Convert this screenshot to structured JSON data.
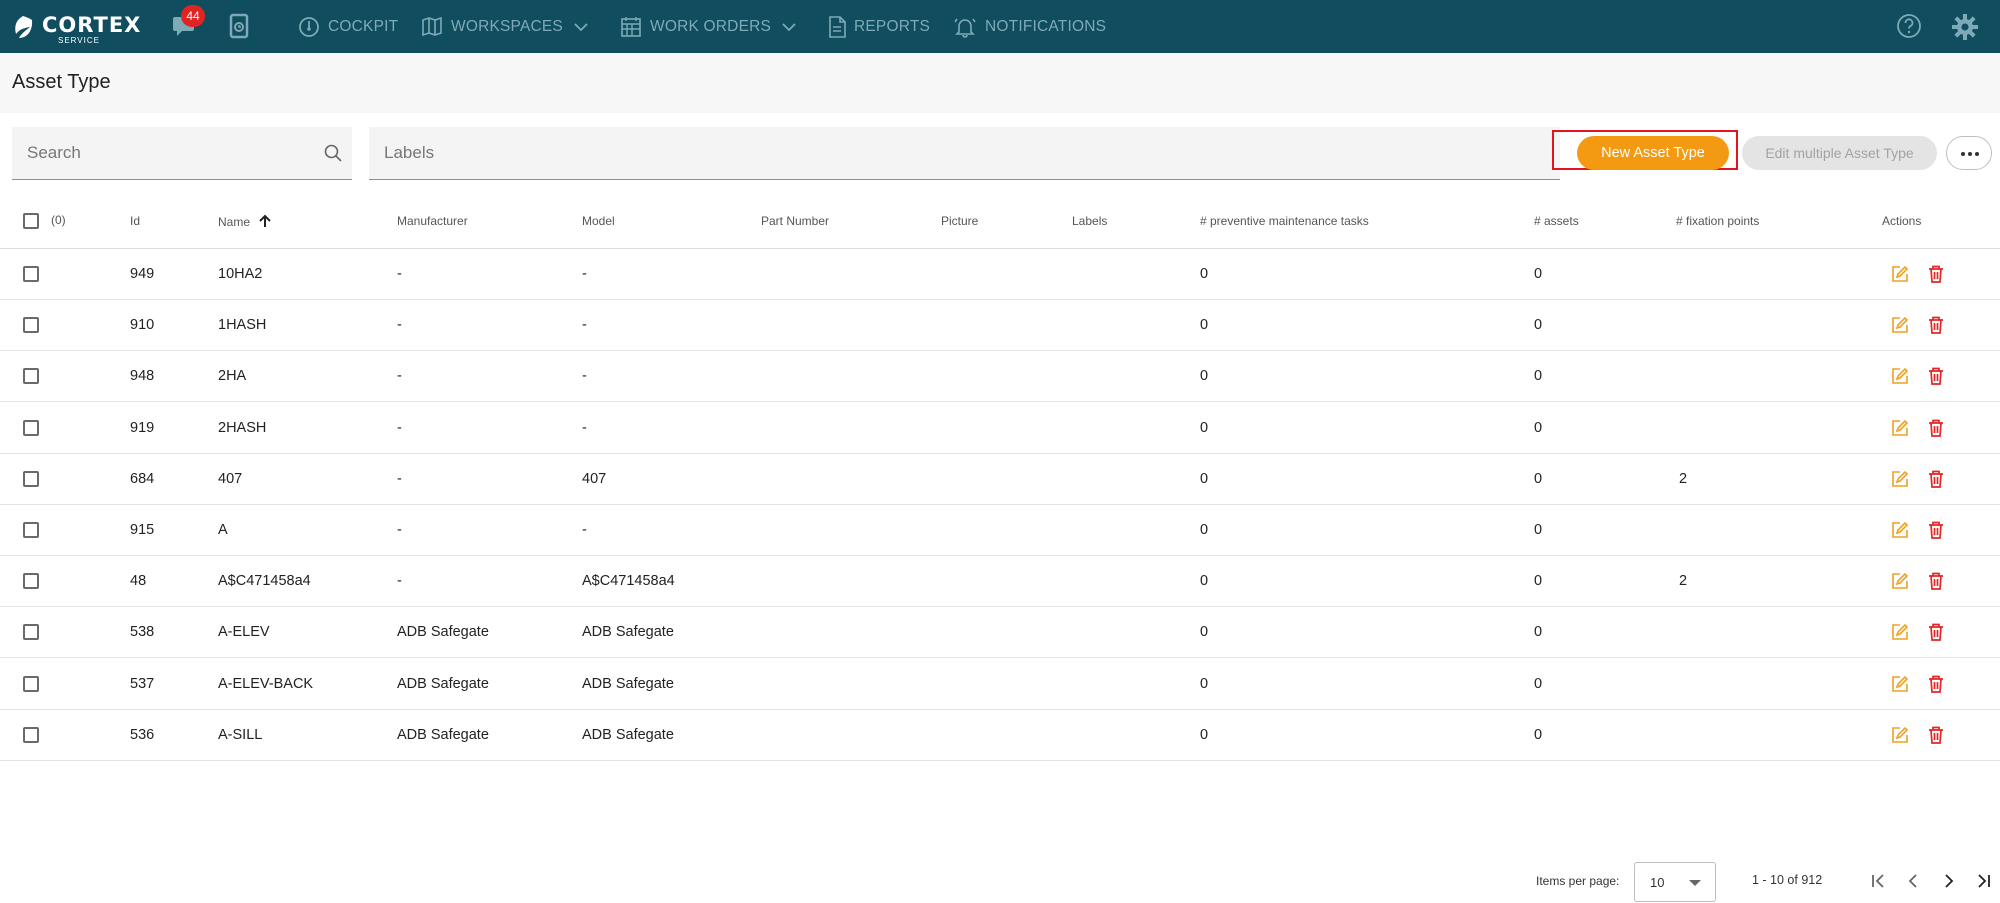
{
  "nav": {
    "brand": "CORTEX",
    "brand_sub": "SERVICE",
    "messages_badge": "44",
    "items": [
      {
        "label": "COCKPIT",
        "icon": "gauge-icon"
      },
      {
        "label": "WORKSPACES",
        "icon": "map-icon"
      },
      {
        "label": "WORK ORDERS",
        "icon": "calendar-icon"
      },
      {
        "label": "REPORTS",
        "icon": "document-icon"
      },
      {
        "label": "NOTIFICATIONS",
        "icon": "bell-icon"
      }
    ],
    "colors": {
      "bar": "#0f4d5f",
      "item": "#7eaab7",
      "badge": "#e02424"
    }
  },
  "page": {
    "title": "Asset Type"
  },
  "filters": {
    "search_placeholder": "Search",
    "labels_placeholder": "Labels"
  },
  "toolbar": {
    "new_label": "New Asset Type",
    "edit_multiple_label": "Edit multiple Asset Type",
    "accent": "#f39a12"
  },
  "table": {
    "selected_count": "(0)",
    "headers": {
      "id": "Id",
      "name": "Name",
      "manufacturer": "Manufacturer",
      "model": "Model",
      "part_number": "Part Number",
      "picture": "Picture",
      "labels": "Labels",
      "pm_tasks": "# preventive maintenance tasks",
      "assets": "# assets",
      "fixation": "# fixation points",
      "actions": "Actions"
    },
    "rows": [
      {
        "id": "949",
        "name": "10HA2",
        "manufacturer": "-",
        "model": "-",
        "pm": "0",
        "assets": "0",
        "fix": ""
      },
      {
        "id": "910",
        "name": "1HASH",
        "manufacturer": "-",
        "model": "-",
        "pm": "0",
        "assets": "0",
        "fix": ""
      },
      {
        "id": "948",
        "name": "2HA",
        "manufacturer": "-",
        "model": "-",
        "pm": "0",
        "assets": "0",
        "fix": ""
      },
      {
        "id": "919",
        "name": "2HASH",
        "manufacturer": "-",
        "model": "-",
        "pm": "0",
        "assets": "0",
        "fix": ""
      },
      {
        "id": "684",
        "name": "407",
        "manufacturer": "-",
        "model": "407",
        "pm": "0",
        "assets": "0",
        "fix": "2"
      },
      {
        "id": "915",
        "name": "A",
        "manufacturer": "-",
        "model": "-",
        "pm": "0",
        "assets": "0",
        "fix": ""
      },
      {
        "id": "48",
        "name": "A$C471458a4",
        "manufacturer": "-",
        "model": "A$C471458a4",
        "pm": "0",
        "assets": "0",
        "fix": "2"
      },
      {
        "id": "538",
        "name": "A-ELEV",
        "manufacturer": "ADB Safegate",
        "model": "ADB Safegate",
        "pm": "0",
        "assets": "0",
        "fix": ""
      },
      {
        "id": "537",
        "name": "A-ELEV-BACK",
        "manufacturer": "ADB Safegate",
        "model": "ADB Safegate",
        "pm": "0",
        "assets": "0",
        "fix": ""
      },
      {
        "id": "536",
        "name": "A-SILL",
        "manufacturer": "ADB Safegate",
        "model": "ADB Safegate",
        "pm": "0",
        "assets": "0",
        "fix": ""
      }
    ],
    "colors": {
      "edit": "#f0a020",
      "delete": "#e32626"
    }
  },
  "pagination": {
    "items_per_page_label": "Items per page:",
    "items_per_page": "10",
    "range": "1 - 10 of 912"
  }
}
